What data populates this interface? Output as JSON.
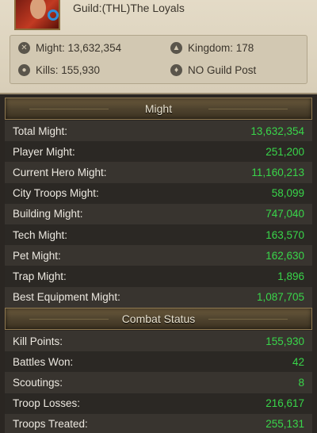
{
  "profile": {
    "guild_line": "Guild:(THL)The Loyals",
    "might_label": "Might: 13,632,354",
    "kingdom_label": "Kingdom: 178",
    "kills_label": "Kills: 155,930",
    "guild_post_label": "NO Guild Post"
  },
  "sections": {
    "might_title": "Might",
    "combat_title": "Combat Status"
  },
  "might_rows": [
    {
      "label": "Total Might:",
      "value": "13,632,354"
    },
    {
      "label": "Player Might:",
      "value": "251,200"
    },
    {
      "label": "Current Hero Might:",
      "value": "11,160,213"
    },
    {
      "label": "City Troops Might:",
      "value": "58,099"
    },
    {
      "label": "Building Might:",
      "value": "747,040"
    },
    {
      "label": "Tech Might:",
      "value": "163,570"
    },
    {
      "label": "Pet Might:",
      "value": "162,630"
    },
    {
      "label": "Trap Might:",
      "value": "1,896"
    },
    {
      "label": "Best Equipment Might:",
      "value": "1,087,705"
    }
  ],
  "combat_rows": [
    {
      "label": "Kill Points:",
      "value": "155,930"
    },
    {
      "label": "Battles Won:",
      "value": "42"
    },
    {
      "label": "Scoutings:",
      "value": "8"
    },
    {
      "label": "Troop Losses:",
      "value": "216,617"
    },
    {
      "label": "Troops Treated:",
      "value": "255,131"
    }
  ],
  "colors": {
    "value_green": "#39d64a",
    "parchment": "#e4dbc7",
    "header_gold": "#6b5a3c"
  },
  "icons": {
    "might": "crossed-swords-icon",
    "kingdom": "helmet-icon",
    "kills": "skull-icon",
    "guild_post": "crest-icon"
  }
}
